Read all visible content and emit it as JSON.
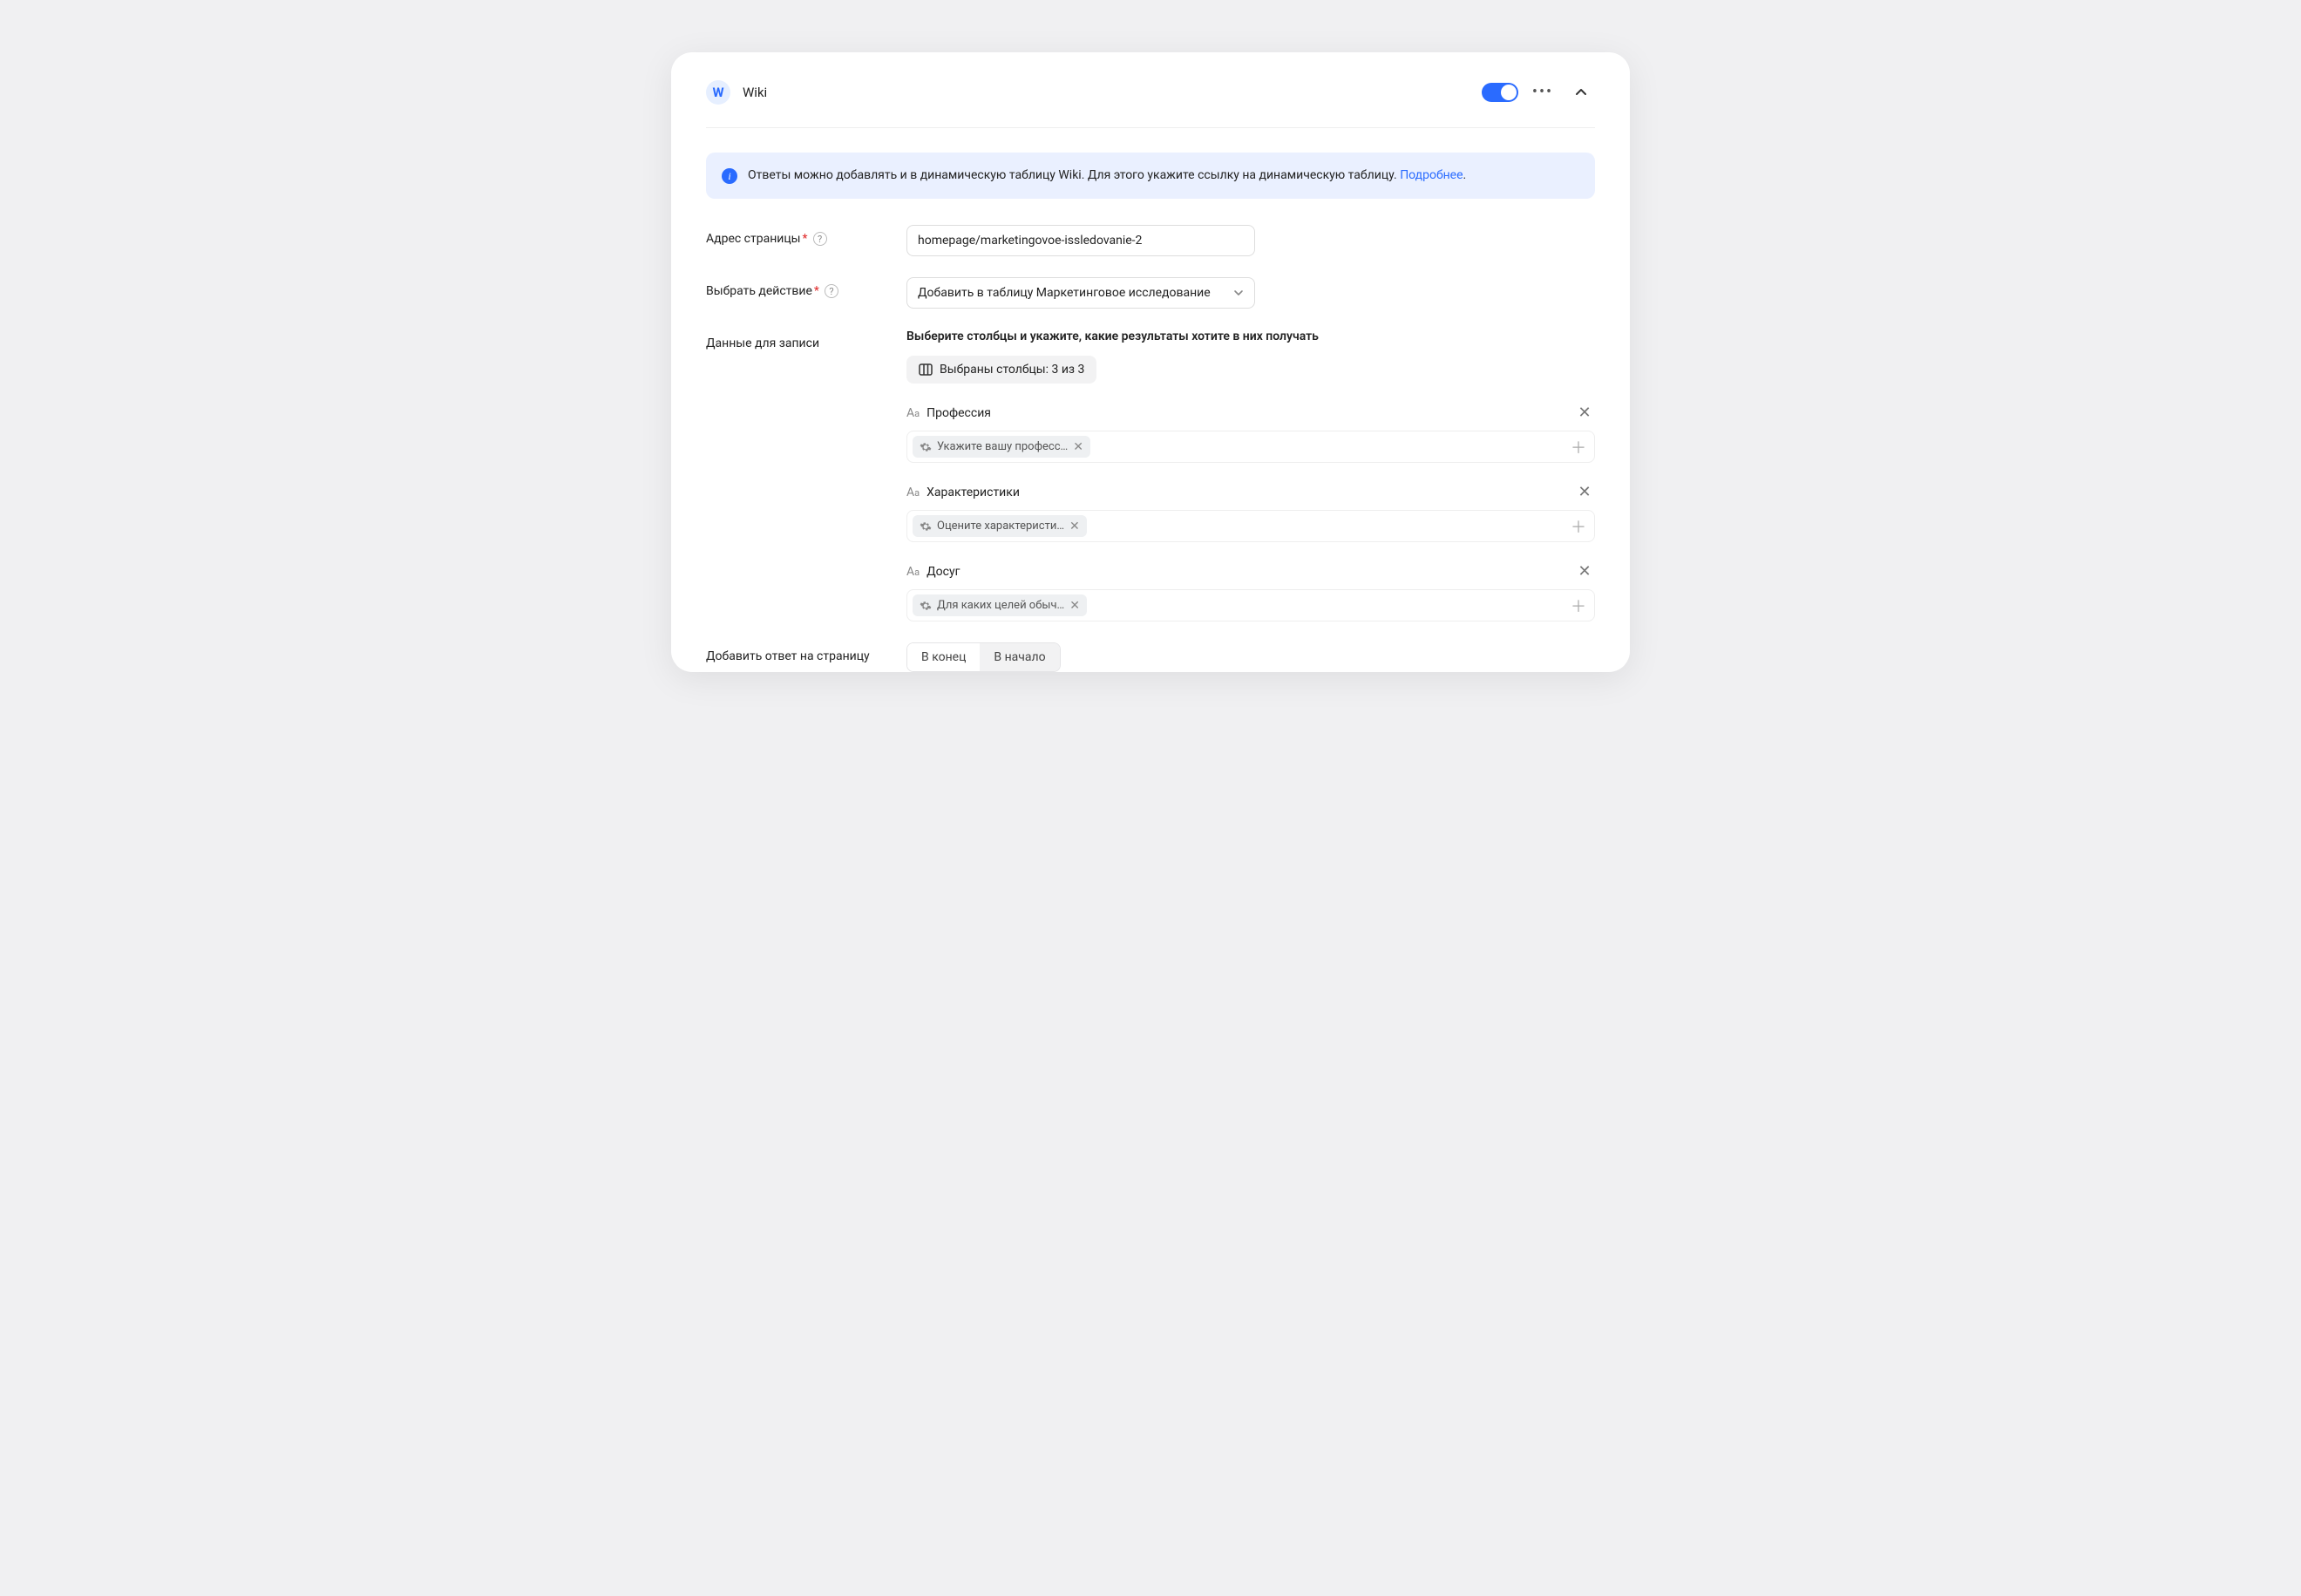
{
  "header": {
    "badge_letter": "W",
    "title": "Wiki",
    "toggle_on": true
  },
  "info": {
    "text": "Ответы можно добавлять и в динамическую таблицу Wiki. Для этого укажите ссылку на динамическую таблицу. ",
    "link_text": "Подробнее",
    "period": "."
  },
  "form": {
    "page_address": {
      "label": "Адрес страницы",
      "value": "homepage/marketingovoe-issledovanie-2"
    },
    "action": {
      "label": "Выбрать действие",
      "value": "Добавить в таблицу Маркетинговое исследование"
    },
    "data_entry": {
      "label": "Данные для записи",
      "heading": "Выберите столбцы и укажите, какие результаты хотите в них получать",
      "selected_columns_label": "Выбраны столбцы: 3 из 3",
      "columns": [
        {
          "name": "Профессия",
          "tag": "Укажите вашу професс…"
        },
        {
          "name": "Характеристики",
          "tag": "Оцените характеристи…"
        },
        {
          "name": "Досуг",
          "tag": "Для каких целей обыч…"
        }
      ]
    },
    "add_answer": {
      "label": "Добавить ответ на страницу",
      "options": [
        "В конец",
        "В начало"
      ],
      "active_index": 0
    }
  }
}
